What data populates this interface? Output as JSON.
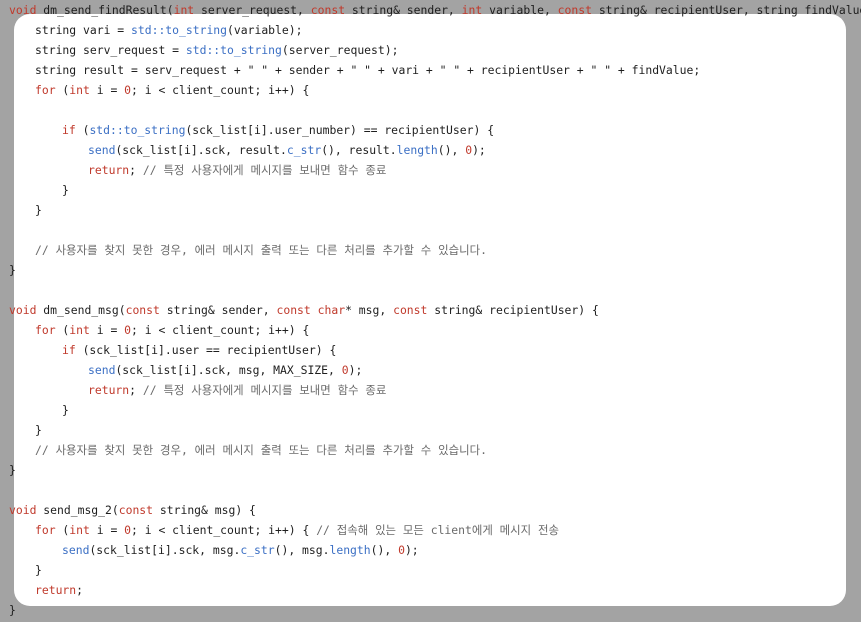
{
  "colors": {
    "background": "#a3a3a3",
    "panel": "#ffffff",
    "keyword": "#c0392b",
    "function": "#3b6fc4",
    "comment": "#6a6a6a",
    "text": "#1e1e1e"
  },
  "code": {
    "l1": [
      {
        "k": "void",
        "c": "k"
      },
      {
        "k": " dm_send_findResult(",
        "c": "t"
      },
      {
        "k": "int",
        "c": "k"
      },
      {
        "k": " server_request, ",
        "c": "t"
      },
      {
        "k": "const",
        "c": "k"
      },
      {
        "k": " string& sender, ",
        "c": "t"
      },
      {
        "k": "int",
        "c": "k"
      },
      {
        "k": " variable, ",
        "c": "t"
      },
      {
        "k": "const",
        "c": "k"
      },
      {
        "k": " string& recipientUser, string findValue) {",
        "c": "t"
      }
    ],
    "l2": [
      {
        "k": "string vari = ",
        "c": "t"
      },
      {
        "k": "std::to_string",
        "c": "f"
      },
      {
        "k": "(variable);",
        "c": "t"
      }
    ],
    "l3": [
      {
        "k": "string serv_request = ",
        "c": "t"
      },
      {
        "k": "std::to_string",
        "c": "f"
      },
      {
        "k": "(server_request);",
        "c": "t"
      }
    ],
    "l4": [
      {
        "k": "string result = serv_request + \" \" + sender + \" \" + vari + \" \" + recipientUser + \" \" + findValue;",
        "c": "t"
      }
    ],
    "l5": [
      {
        "k": "for",
        "c": "k"
      },
      {
        "k": " (",
        "c": "t"
      },
      {
        "k": "int",
        "c": "k"
      },
      {
        "k": " i = ",
        "c": "t"
      },
      {
        "k": "0",
        "c": "k"
      },
      {
        "k": "; i < client_count; i++) {",
        "c": "t"
      }
    ],
    "l7": [
      {
        "k": "if",
        "c": "k"
      },
      {
        "k": " (",
        "c": "t"
      },
      {
        "k": "std::to_string",
        "c": "f"
      },
      {
        "k": "(sck_list[i].user_number) == recipientUser) {",
        "c": "t"
      }
    ],
    "l8": [
      {
        "k": "send",
        "c": "f"
      },
      {
        "k": "(sck_list[i].sck, result.",
        "c": "t"
      },
      {
        "k": "c_str",
        "c": "f"
      },
      {
        "k": "(), result.",
        "c": "t"
      },
      {
        "k": "length",
        "c": "f"
      },
      {
        "k": "(), ",
        "c": "t"
      },
      {
        "k": "0",
        "c": "k"
      },
      {
        "k": ");",
        "c": "t"
      }
    ],
    "l9": [
      {
        "k": "return",
        "c": "k"
      },
      {
        "k": "; ",
        "c": "t"
      },
      {
        "k": "// 특정 사용자에게 메시지를 보내면 함수 종료",
        "c": "c"
      }
    ],
    "l10": [
      {
        "k": "}",
        "c": "t"
      }
    ],
    "l11": [
      {
        "k": "}",
        "c": "t"
      }
    ],
    "l13": [
      {
        "k": "// 사용자를 찾지 못한 경우, 에러 메시지 출력 또는 다른 처리를 추가할 수 있습니다.",
        "c": "c"
      }
    ],
    "l14": [
      {
        "k": "}",
        "c": "t"
      }
    ],
    "l16": [
      {
        "k": "void",
        "c": "k"
      },
      {
        "k": " dm_send_msg(",
        "c": "t"
      },
      {
        "k": "const",
        "c": "k"
      },
      {
        "k": " string& sender, ",
        "c": "t"
      },
      {
        "k": "const",
        "c": "k"
      },
      {
        "k": " ",
        "c": "t"
      },
      {
        "k": "char",
        "c": "k"
      },
      {
        "k": "* msg, ",
        "c": "t"
      },
      {
        "k": "const",
        "c": "k"
      },
      {
        "k": " string& recipientUser) {",
        "c": "t"
      }
    ],
    "l17": [
      {
        "k": "for",
        "c": "k"
      },
      {
        "k": " (",
        "c": "t"
      },
      {
        "k": "int",
        "c": "k"
      },
      {
        "k": " i = ",
        "c": "t"
      },
      {
        "k": "0",
        "c": "k"
      },
      {
        "k": "; i < client_count; i++) {",
        "c": "t"
      }
    ],
    "l18": [
      {
        "k": "if",
        "c": "k"
      },
      {
        "k": " (sck_list[i].user == recipientUser) {",
        "c": "t"
      }
    ],
    "l19": [
      {
        "k": "send",
        "c": "f"
      },
      {
        "k": "(sck_list[i].sck, msg, MAX_SIZE, ",
        "c": "t"
      },
      {
        "k": "0",
        "c": "k"
      },
      {
        "k": ");",
        "c": "t"
      }
    ],
    "l20": [
      {
        "k": "return",
        "c": "k"
      },
      {
        "k": "; ",
        "c": "t"
      },
      {
        "k": "// 특정 사용자에게 메시지를 보내면 함수 종료",
        "c": "c"
      }
    ],
    "l21": [
      {
        "k": "}",
        "c": "t"
      }
    ],
    "l22": [
      {
        "k": "}",
        "c": "t"
      }
    ],
    "l23": [
      {
        "k": "// 사용자를 찾지 못한 경우, 에러 메시지 출력 또는 다른 처리를 추가할 수 있습니다.",
        "c": "c"
      }
    ],
    "l24": [
      {
        "k": "}",
        "c": "t"
      }
    ],
    "l26": [
      {
        "k": "void",
        "c": "k"
      },
      {
        "k": " send_msg_2(",
        "c": "t"
      },
      {
        "k": "const",
        "c": "k"
      },
      {
        "k": " string& msg) {",
        "c": "t"
      }
    ],
    "l27": [
      {
        "k": "for",
        "c": "k"
      },
      {
        "k": " (",
        "c": "t"
      },
      {
        "k": "int",
        "c": "k"
      },
      {
        "k": " i = ",
        "c": "t"
      },
      {
        "k": "0",
        "c": "k"
      },
      {
        "k": "; i < client_count; i++) { ",
        "c": "t"
      },
      {
        "k": "// 접속해 있는 모든 client에게 메시지 전송",
        "c": "c"
      }
    ],
    "l28": [
      {
        "k": "send",
        "c": "f"
      },
      {
        "k": "(sck_list[i].sck, msg.",
        "c": "t"
      },
      {
        "k": "c_str",
        "c": "f"
      },
      {
        "k": "(), msg.",
        "c": "t"
      },
      {
        "k": "length",
        "c": "f"
      },
      {
        "k": "(), ",
        "c": "t"
      },
      {
        "k": "0",
        "c": "k"
      },
      {
        "k": ");",
        "c": "t"
      }
    ],
    "l29": [
      {
        "k": "}",
        "c": "t"
      }
    ],
    "l30": [
      {
        "k": "return",
        "c": "k"
      },
      {
        "k": ";",
        "c": "t"
      }
    ],
    "l31": [
      {
        "k": "}",
        "c": "t"
      }
    ]
  }
}
